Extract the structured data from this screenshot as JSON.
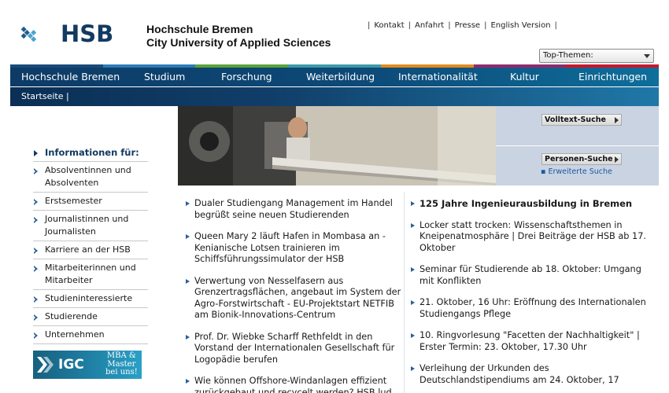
{
  "header": {
    "logo_text": "HSB",
    "uni_line1": "Hochschule Bremen",
    "uni_line2": "City University of Applied Sciences",
    "top_links": [
      "Kontakt",
      "Anfahrt",
      "Presse",
      "English Version"
    ],
    "dropdown_value": "Top-Themen:"
  },
  "colors": {
    "brand_dark": "#123a62",
    "nav_blue": "#0d3b66",
    "stripe": [
      "#1a4a7a",
      "#2d7bb6",
      "#5ba23a",
      "#e38b1e",
      "#8f2b6c",
      "#c8182c",
      "#5a6e8c"
    ]
  },
  "mainnav": [
    "Hochschule Bremen",
    "Studium",
    "Forschung",
    "Weiterbildung",
    "Internationalität",
    "Kultur",
    "Einrichtungen"
  ],
  "subnav": {
    "crumb": "Startseite  |"
  },
  "search": {
    "volltext": "Volltext-Suche",
    "personen": "Personen-Suche",
    "advanced": "Erweiterte Suche"
  },
  "sidebar": {
    "heading": "Informationen für:",
    "items": [
      "Absolventinnen und Absolventen",
      "Erstsemester",
      "Journalistinnen und Journalisten",
      "Karriere an der HSB",
      "Mitarbeiterinnen und Mitarbeiter",
      "Studieninteressierte",
      "Studierende",
      "Unternehmen"
    ]
  },
  "banner": {
    "big": "IGC",
    "small1": "MBA &",
    "small2": "Master",
    "small3": "bei uns!"
  },
  "news_left": [
    "Dualer Studiengang Management im Handel begrüßt seine neuen Studierenden",
    "Queen Mary 2 läuft Hafen in Mombasa an - Kenianische Lotsen trainieren im Schiffsführungssimulator der HSB",
    "Verwertung von Nesselfasern aus Grenzertragsflächen, angebaut im System der Agro-Forstwirtschaft - EU-Projektstart NETFIB am Bionik-Innovations-Centrum",
    "Prof. Dr. Wiebke Scharff Rethfeldt in den Vorstand der Internationalen Gesellschaft für Logopädie berufen",
    "Wie können Offshore-Windanlagen effizient zurückgebaut und recycelt werden? HSB lud"
  ],
  "news_right_head": "125 Jahre Ingenieurausbildung in Bremen",
  "news_right": [
    "Locker statt trocken: Wissenschaftsthemen in Kneipenatmosphäre | Drei Beiträge der HSB ab 17. Oktober",
    "Seminar für Studierende ab 18. Oktober: Umgang mit Konflikten",
    "21. Oktober, 16 Uhr: Eröffnung des Internationalen Studiengangs Pflege",
    "10. Ringvorlesung \"Facetten der Nachhaltigkeit\" | Erster Termin: 23. Oktober, 17.30 Uhr",
    "Verleihung der Urkunden des Deutschlandstipendiums am 24. Oktober, 17"
  ]
}
